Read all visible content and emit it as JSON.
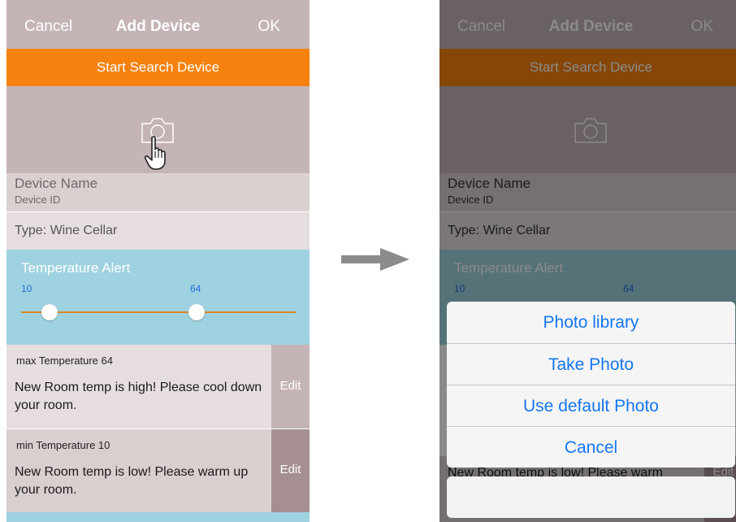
{
  "left_screen": {
    "nav": {
      "cancel": "Cancel",
      "title": "Add Device",
      "ok": "OK"
    },
    "search_button": "Start Search Device",
    "device_name": "Device Name",
    "device_id": "Device ID",
    "type": "Type: Wine Cellar",
    "temp_alert": {
      "title": "Temperature Alert",
      "min_value": "10",
      "max_value": "64"
    },
    "max_alert": {
      "label": "max Temperature 64",
      "message": "New Room temp is high! Please cool down your room.",
      "edit": "Edit"
    },
    "min_alert": {
      "label": "min Temperature 10",
      "message": "New Room temp is low! Please warm up your room.",
      "edit": "Edit"
    }
  },
  "right_screen": {
    "nav": {
      "cancel": "Cancel",
      "title": "Add Device",
      "ok": "OK"
    },
    "search_button": "Start Search Device",
    "device_name": "Device Name",
    "device_id": "Device ID",
    "type": "Type: Wine Cellar",
    "temp_alert": {
      "title": "Temperature Alert",
      "min_value": "10",
      "max_value": "64"
    },
    "min_alert_message": "New Room temp is low! Please warm",
    "min_alert_edit": "Edit",
    "action_sheet": {
      "options": [
        "Photo library",
        "Take Photo",
        "Use default Photo",
        "Cancel"
      ]
    }
  },
  "icons": {
    "camera": "camera-icon",
    "pointer": "hand-pointer-icon",
    "arrow": "right-arrow-icon"
  },
  "colors": {
    "nav_bg": "#c5b4b5",
    "search_bg": "#f5820e",
    "alert_bg": "#9fd2e0",
    "slider_track": "#d98622",
    "action_text": "#1476f0"
  }
}
